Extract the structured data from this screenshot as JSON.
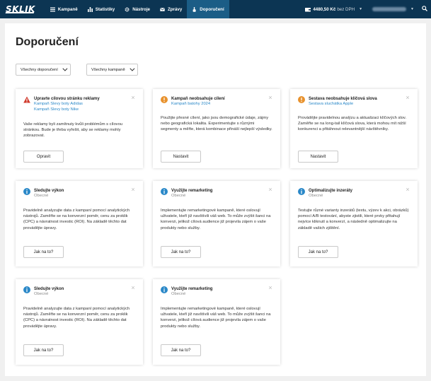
{
  "topbar": {
    "logo": "SKLIK",
    "nav": [
      {
        "label": "Kampaně",
        "icon": "hamburger-icon"
      },
      {
        "label": "Statistiky",
        "icon": "bar-chart-icon"
      },
      {
        "label": "Nástroje",
        "icon": "gear-icon"
      },
      {
        "label": "Zprávy",
        "icon": "envelope-icon"
      },
      {
        "label": "Doporučení",
        "icon": "pointing-hand-icon"
      }
    ],
    "active": "Doporučení",
    "wallet_amount": "4480,50 Kč",
    "wallet_sub": "bez DPH"
  },
  "page": {
    "title": "Doporučení",
    "filters": [
      "Všechny doporučení",
      "Všechny kampaně"
    ]
  },
  "cards": [
    {
      "type": "error",
      "icon": "warning-triangle-icon",
      "title": "Upravte cílovou stránku reklamy",
      "subs": [
        "Kampaň Slevy boty Adidas",
        "Kampaň Slevy boty Nike"
      ],
      "body": "Vaše reklamy byli zamítnuty kvůli problémům s cílovou stránkou. Bude je třeba vyřešit, aby se reklamy mohly zobrazovat.",
      "button": "Opravit"
    },
    {
      "type": "warning",
      "icon": "exclamation-circle-icon",
      "title": "Kampaň neobsahuje cílení",
      "subs": [
        "Kampaň batohy 2024"
      ],
      "body": "Použijte přesné cílení, jako jsou demografické údaje, zájmy nebo geografická lokalita. Experimentujte s různými segmenty a měřte, která kombinace přináší nejlepší výsledky.",
      "button": "Nastavit"
    },
    {
      "type": "warning",
      "icon": "exclamation-circle-icon",
      "title": "Sestava neobsahuje klíčová slova",
      "subs": [
        "Sestava sluchátka Apple"
      ],
      "body": "Provádějte pravidelnou analýzu a aktualizaci klíčových slov. Zaměřte se na long-tail klíčová slova, která mohou mít nižší konkurenci a přitáhnout relevantnější návštěvníky.",
      "button": "Nastavit"
    },
    {
      "type": "info",
      "icon": "info-circle-icon",
      "title": "Sledujte výkon",
      "subs": [
        "Obecné"
      ],
      "body": "Pravidelně analyzujte data z kampaní pomocí analytických nástrojů. Zaměřte se na konverzní poměr, cenu za proklik (CPC) a návratnost investic (ROI). Na základě těchto dat provádějte úpravy.",
      "button": "Jak na to?"
    },
    {
      "type": "info",
      "icon": "info-circle-icon",
      "title": "Využijte remarketing",
      "subs": [
        "Obecné"
      ],
      "body": "Implementujte remarketingové kampaně, které oslovují uživatele, kteří již navštívili váš web. To může zvýšit šanci na konverzi, jelikož cílová audience již projevila zájem o vaše produkty nebo služby.",
      "button": "Jak na to?"
    },
    {
      "type": "info",
      "icon": "info-circle-icon",
      "title": "Optimalizujte inzeráty",
      "subs": [
        "Obecné"
      ],
      "body": "Testujte různé varianty inzerátů (textu, výzev k akci, obrázků) pomocí A/B testování, abyste zjistili, které prvky přitahují nejvíce kliknutí a konverzí, a následně optimalizujte na základě vašich zjištění.",
      "button": "Jak na to?"
    },
    {
      "type": "info",
      "icon": "info-circle-icon",
      "title": "Sledujte výkon",
      "subs": [
        "Obecné"
      ],
      "body": "Pravidelně analyzujte data z kampaní pomocí analytických nástrojů. Zaměřte se na konverzní poměr, cenu za proklik (CPC) a návratnost investic (ROI). Na základě těchto dat provádějte úpravy.",
      "button": "Jak na to?"
    },
    {
      "type": "info",
      "icon": "info-circle-icon",
      "title": "Využijte remarketing",
      "subs": [
        "Obecné"
      ],
      "body": "Implementujte remarketingové kampaně, které oslovují uživatele, kteří již navštívili váš web. To může zvýšit šanci na konverzi, jelikož cílová audience již projevila zájem o vaše produkty nebo služby.",
      "button": "Jak na to?"
    }
  ],
  "colors": {
    "nav_bg": "#0c3553",
    "nav_active": "#1b5d86",
    "error": "#d0392b",
    "warning": "#e8922d",
    "info": "#2a88c8",
    "link": "#2a88c8"
  }
}
